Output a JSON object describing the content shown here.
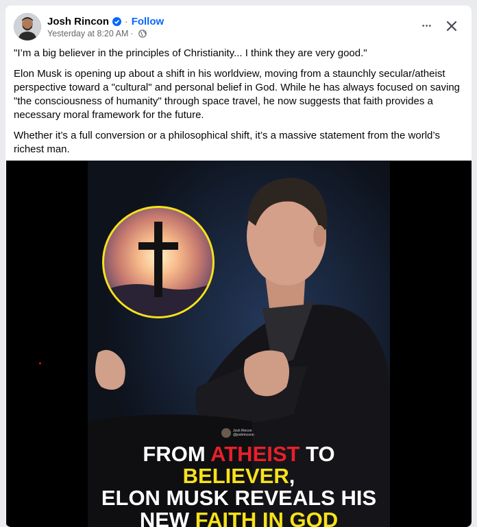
{
  "post": {
    "author": "Josh Rincon",
    "follow_label": "Follow",
    "timestamp": "Yesterday at 8:20 AM",
    "separator": "·",
    "more_label": "•••",
    "paragraphs": [
      "\"I’m a big believer in the principles of Christianity... I think they are very good.\"",
      "Elon Musk is opening up about a shift in his worldview, moving from a staunchly secular/atheist perspective toward a \"cultural\" and personal belief in God. While he has always focused on saving \"the consciousness of humanity\" through space travel, he now suggests that faith provides a necessary moral framework for the future.",
      "Whether it’s a full conversion or a philosophical shift, it’s a massive statement from the world’s richest man."
    ]
  },
  "image": {
    "watermark_name": "Josh Rincon",
    "watermark_handle": "@joshrincono",
    "headline": {
      "line1_a": "FROM ",
      "line1_b": "ATHEIST",
      "line1_c": " TO ",
      "line1_d": "BELIEVER",
      "line1_e": ",",
      "line2": "ELON MUSK REVEALS HIS",
      "line3_a": "NEW ",
      "line3_b": "FAITH IN GOD"
    }
  },
  "colors": {
    "link_blue": "#0866ff",
    "headline_red": "#e8202a",
    "headline_yellow": "#f7e21b",
    "circle_border": "#f5e21b"
  },
  "icons": {
    "verified": "verified-badge-icon",
    "audience": "globe-icon",
    "more": "more-options-icon",
    "close": "close-icon"
  }
}
